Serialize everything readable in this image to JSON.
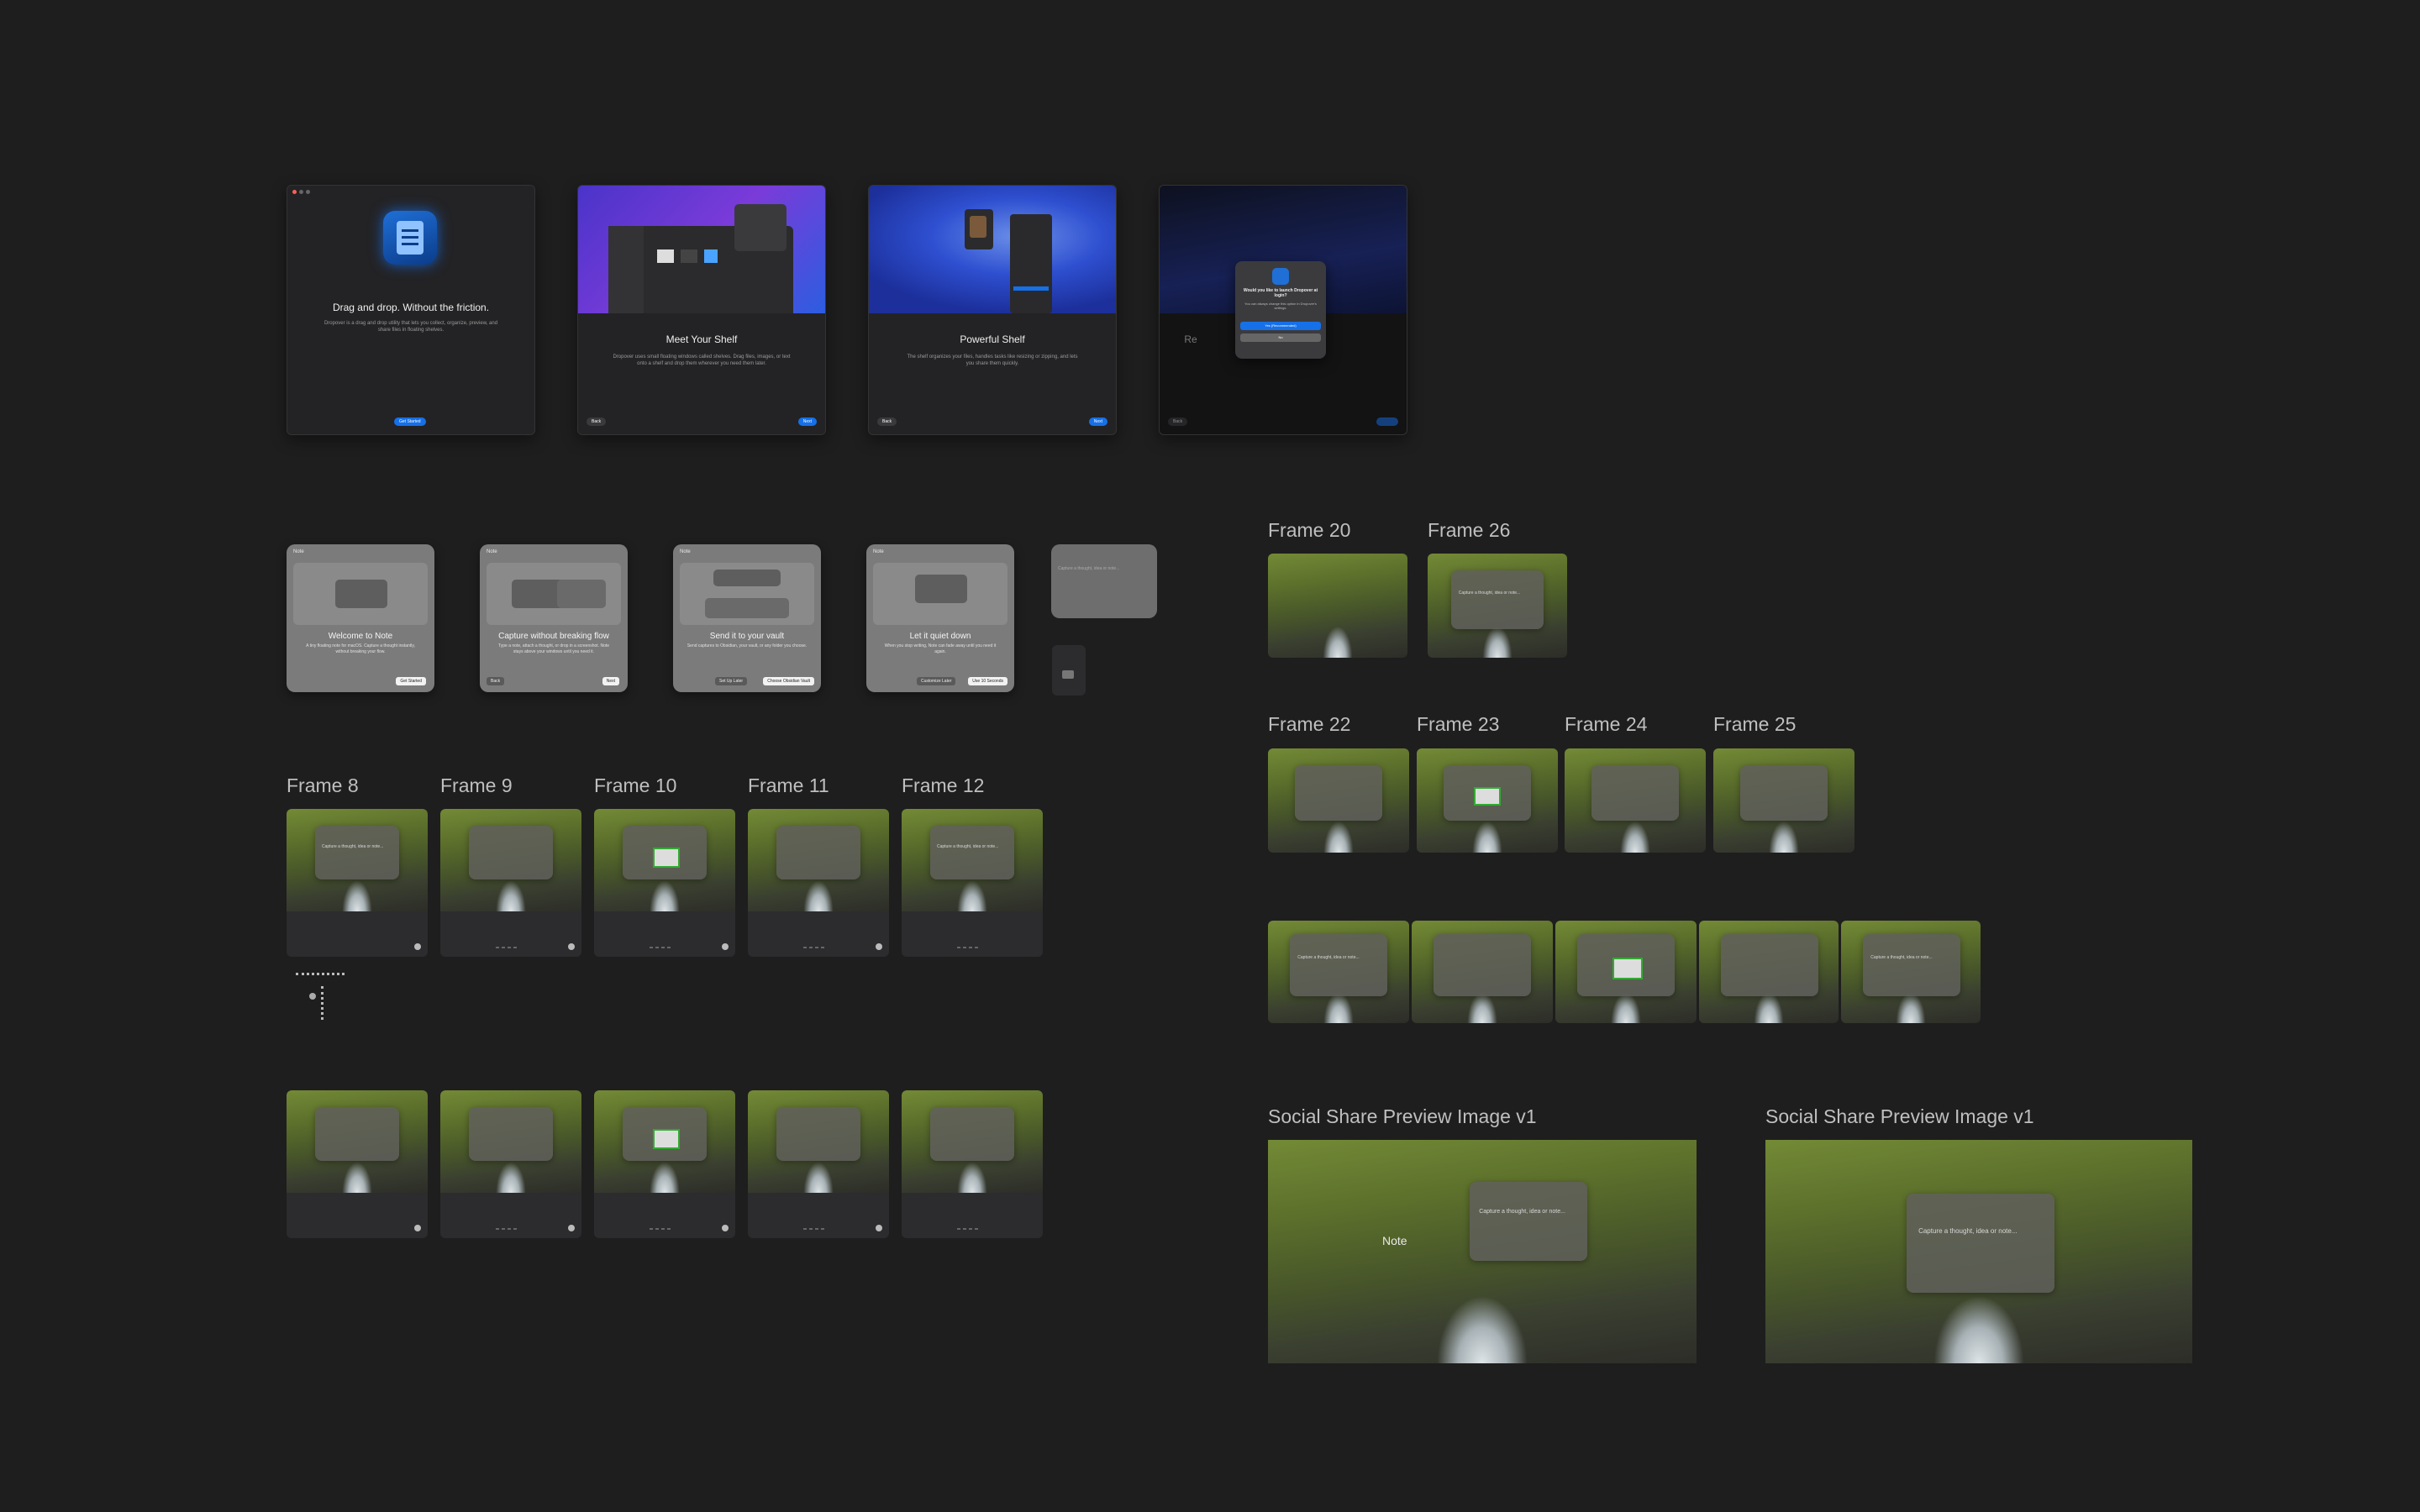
{
  "onboarding": [
    {
      "title": "Drag and drop. Without the friction.",
      "body": "Dropover is a drag and drop utility that lets you collect, organize, preview, and share files in floating shelves.",
      "primary": "Get Started",
      "secondary": ""
    },
    {
      "title": "Meet Your Shelf",
      "body": "Dropover uses small floating windows called shelves. Drag files, images, or text onto a shelf and drop them wherever you need them later.",
      "primary": "Next",
      "secondary": "Back"
    },
    {
      "title": "Powerful Shelf",
      "body": "The shelf organizes your files, handles tasks like resizing or zipping, and lets you share them quickly.",
      "primary": "Next",
      "secondary": "Back"
    },
    {
      "title": "Re",
      "body": "",
      "primary": "",
      "secondary": "Back",
      "dialog_title": "Would you like to launch Dropover at login?",
      "dialog_body": "You can always change this option in Dropover's settings.",
      "dialog_yes": "Yes (Recommended)",
      "dialog_no": "No"
    }
  ],
  "note_cards": [
    {
      "app": "Note",
      "title": "Welcome to Note",
      "text": "A tiny floating note for macOS. Capture a thought instantly, without breaking your flow.",
      "primary": "Get Started",
      "secondary": ""
    },
    {
      "app": "Note",
      "title": "Capture without breaking flow",
      "text": "Type a note, attach a thought, or drop in a screenshot. Note stays above your windows until you need it.",
      "primary": "Next",
      "secondary": "Back"
    },
    {
      "app": "Note",
      "title": "Send it to your vault",
      "text": "Send captures to Obsidian, your vault, or any folder you choose.",
      "primary": "Choose Obsidian Vault",
      "secondary": "Set Up Later"
    },
    {
      "app": "Note",
      "title": "Let it quiet down",
      "text": "When you stop writing, Note can fade away until you need it again.",
      "primary": "Use 10 Seconds",
      "secondary": "Customize Later"
    }
  ],
  "side_note": "Capture a thought, idea or note...",
  "frame_labels": {
    "f8": "Frame 8",
    "f9": "Frame 9",
    "f10": "Frame 10",
    "f11": "Frame 11",
    "f12": "Frame 12",
    "f20": "Frame 20",
    "f26": "Frame 26",
    "f22": "Frame 22",
    "f23": "Frame 23",
    "f24": "Frame 24",
    "f25": "Frame 25",
    "share1": "Social Share Preview Image v1",
    "share2": "Social Share Preview Image v1"
  },
  "placeholder": "Capture a thought, idea or note...",
  "share_brand": "Note",
  "colors": {
    "background": "#1e1e1e",
    "accent_blue": "#1670e8",
    "moss": "#6b8232"
  }
}
